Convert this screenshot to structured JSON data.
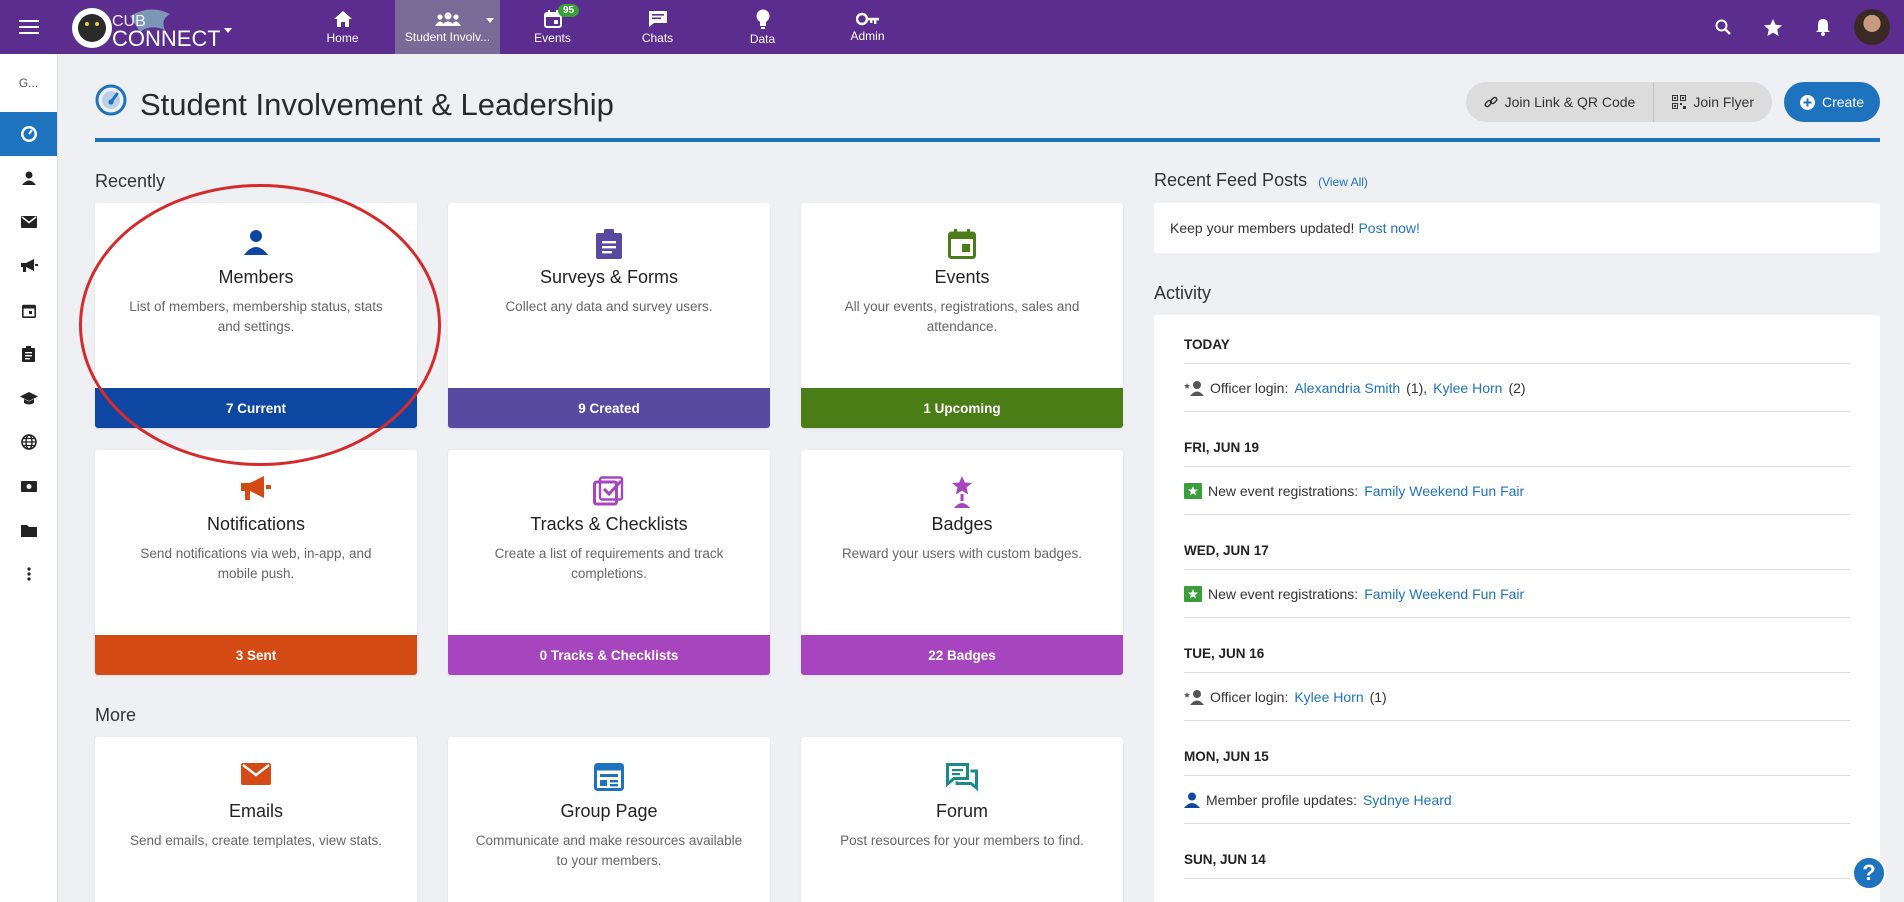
{
  "app": {
    "logo_text": "CUB CONNECT",
    "nav": [
      {
        "label": "Home"
      },
      {
        "label": "Student Involv..."
      },
      {
        "label": "Events",
        "badge": "95"
      },
      {
        "label": "Chats"
      },
      {
        "label": "Data"
      },
      {
        "label": "Admin"
      }
    ],
    "sidebar_org": "G..."
  },
  "header": {
    "title": "Student Involvement & Leadership",
    "join_link_label": "Join Link & QR Code",
    "join_flyer_label": "Join Flyer",
    "create_label": "Create"
  },
  "recently": {
    "label": "Recently",
    "cards": [
      {
        "title": "Members",
        "desc": "List of members, membership status, stats and settings.",
        "footer": "7 Current",
        "color": "#0d47a1"
      },
      {
        "title": "Surveys & Forms",
        "desc": "Collect any data and survey users.",
        "footer": "9 Created",
        "color": "#574aa0"
      },
      {
        "title": "Events",
        "desc": "All your events, registrations, sales and attendance.",
        "footer": "1 Upcoming",
        "color": "#4b7d16"
      },
      {
        "title": "Notifications",
        "desc": "Send notifications via web, in-app, and mobile push.",
        "footer": "3 Sent",
        "color": "#d44a14"
      },
      {
        "title": "Tracks & Checklists",
        "desc": "Create a list of requirements and track completions.",
        "footer": "0 Tracks & Checklists",
        "color": "#a745bf"
      },
      {
        "title": "Badges",
        "desc": "Reward your users with custom badges.",
        "footer": "22 Badges",
        "color": "#a745bf"
      }
    ]
  },
  "more": {
    "label": "More",
    "cards": [
      {
        "title": "Emails",
        "desc": "Send emails, create templates, view stats."
      },
      {
        "title": "Group Page",
        "desc": "Communicate and make resources available to your members."
      },
      {
        "title": "Forum",
        "desc": "Post resources for your members to find."
      }
    ]
  },
  "feed": {
    "title": "Recent Feed Posts",
    "view_all": "(View All)",
    "text": "Keep your members updated!",
    "post_now": "Post now!"
  },
  "activity": {
    "title": "Activity",
    "days": [
      {
        "day": "TODAY",
        "prefix": "Officer login:",
        "links": [
          {
            "name": "Alexandria Smith",
            "count": "(1),"
          },
          {
            "name": "Kylee Horn",
            "count": "(2)"
          }
        ]
      },
      {
        "day": "FRI, JUN 19",
        "prefix": "New event registrations:",
        "links": [
          {
            "name": "Family Weekend Fun Fair",
            "count": ""
          }
        ]
      },
      {
        "day": "WED, JUN 17",
        "prefix": "New event registrations:",
        "links": [
          {
            "name": "Family Weekend Fun Fair",
            "count": ""
          }
        ]
      },
      {
        "day": "TUE, JUN 16",
        "prefix": "Officer login:",
        "links": [
          {
            "name": "Kylee Horn",
            "count": "(1)"
          }
        ]
      },
      {
        "day": "MON, JUN 15",
        "prefix": "Member profile updates:",
        "links": [
          {
            "name": "Sydnye Heard",
            "count": ""
          }
        ]
      },
      {
        "day": "SUN, JUN 14",
        "prefix": "",
        "links": []
      }
    ]
  },
  "help_label": "?"
}
